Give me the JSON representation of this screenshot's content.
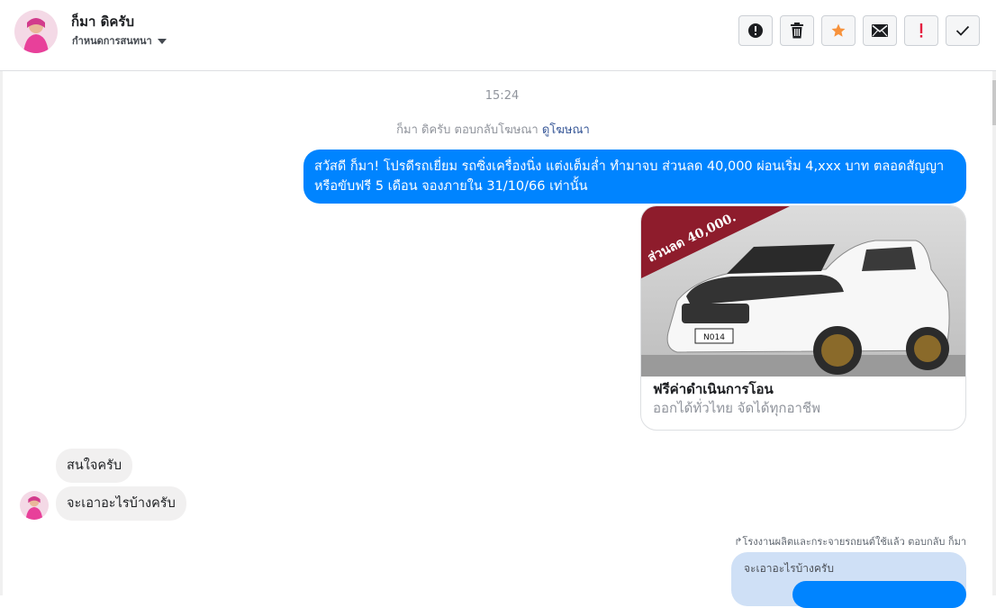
{
  "header": {
    "contact_name": "ก็มา ดิครับ",
    "conversation_settings": "กำหนดการสนทนา",
    "toolbar": {
      "buttons": [
        {
          "name": "mark-spam-button",
          "icon": "alert-circle-icon"
        },
        {
          "name": "delete-button",
          "icon": "trash-icon"
        },
        {
          "name": "star-button",
          "icon": "star-icon",
          "color": "#f7923b"
        },
        {
          "name": "mark-unread-button",
          "icon": "envelope-icon"
        },
        {
          "name": "important-button",
          "icon": "exclamation-icon",
          "color": "#e41e3f"
        },
        {
          "name": "mark-done-button",
          "icon": "check-icon"
        }
      ]
    }
  },
  "thread": {
    "timestamp": "15:24",
    "replied_note": {
      "text": "ก็มา ดิครับ ตอบกลับโฆษณา",
      "link": "ดูโฆษณา"
    },
    "outgoing_message": "สวัสดี ก็มา! โปรดีรถเยี่ยม รถซิ่งเครื่องนิ่ง แต่งเต็มล่ำ ทำมาจบ ส่วนลด 40,000 ผ่อนเริ่ม 4,xxx บาท ตลอดสัญญา หรือขับฟรี 5 เดือน จองภายใน 31/10/66 เท่านั้น",
    "ad_card": {
      "banner_text": "ส่วนลด 40,000.",
      "plate": "N014",
      "title": "ฟรีค่าดำเนินการโอน",
      "subtitle": "ออกได้ทั่วไทย จัดได้ทุกอาชีพ"
    },
    "incoming_messages": [
      "สนใจครับ",
      "จะเอาอะไรบ้างครับ"
    ],
    "forward_note": "โรงงานผลิตและกระจายรถยนต์ใช้แล้ว ตอบกลับ ก็มา",
    "quoted_reply": "จะเอาอะไรบ้างครับ"
  },
  "colors": {
    "outgoing_bubble": "#0084ff",
    "incoming_bubble": "#f1f0f0",
    "link": "#385898"
  }
}
